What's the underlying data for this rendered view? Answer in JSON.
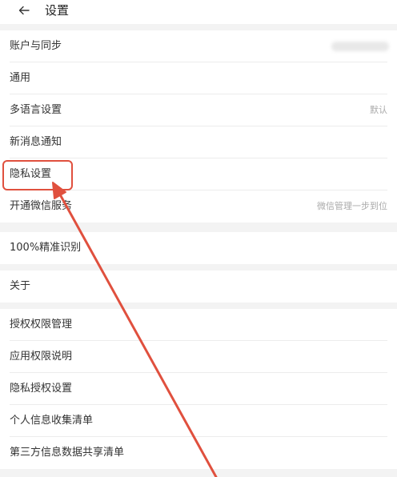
{
  "header": {
    "title": "设置"
  },
  "groups": [
    {
      "items": [
        {
          "label": "账户与同步",
          "value": "",
          "blurred_value": true
        },
        {
          "label": "通用",
          "value": ""
        },
        {
          "label": "多语言设置",
          "value": "默认"
        },
        {
          "label": "新消息通知",
          "value": ""
        },
        {
          "label": "隐私设置",
          "value": ""
        },
        {
          "label": "开通微信服务",
          "value": "微信管理一步到位"
        }
      ]
    },
    {
      "items": [
        {
          "label": "100%精准识别",
          "value": ""
        }
      ]
    },
    {
      "items": [
        {
          "label": "关于",
          "value": ""
        }
      ]
    },
    {
      "items": [
        {
          "label": "授权权限管理",
          "value": ""
        },
        {
          "label": "应用权限说明",
          "value": ""
        },
        {
          "label": "隐私授权设置",
          "value": ""
        },
        {
          "label": "个人信息收集清单",
          "value": ""
        },
        {
          "label": "第三方信息数据共享清单",
          "value": ""
        }
      ]
    }
  ],
  "annotation": {
    "highlight_color": "#e0503e",
    "highlighted_item": "隐私设置"
  },
  "colors": {
    "background": "#f3f3f3",
    "card": "#ffffff",
    "text": "#333333",
    "secondary_text": "#aaaaaa",
    "accent": "#e0503e"
  },
  "icons": {
    "back": "arrow-left-icon"
  }
}
